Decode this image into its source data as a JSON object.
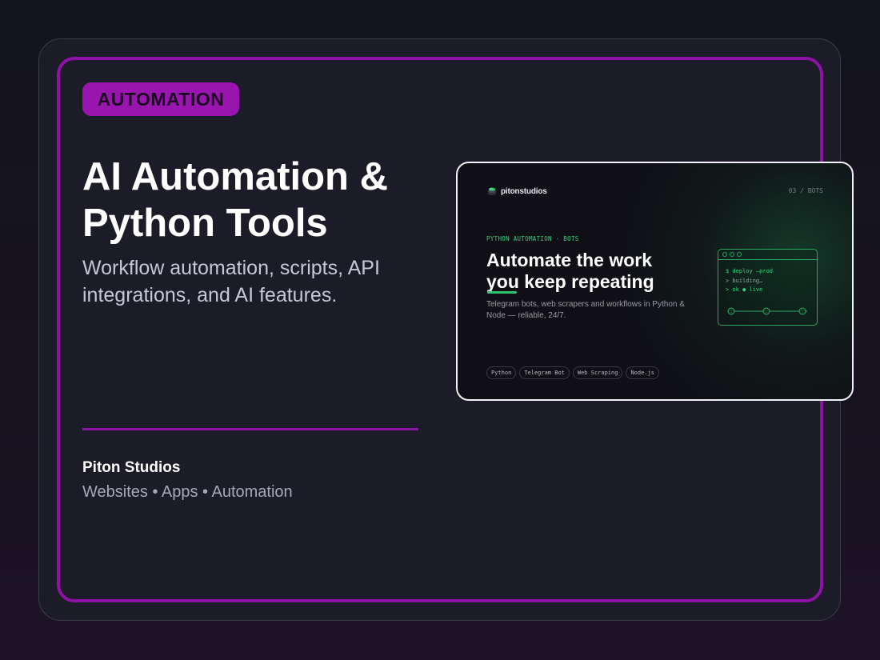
{
  "category": "AUTOMATION",
  "headline": "AI Automation & Python Tools",
  "subheadline": "Workflow automation, scripts, API integrations, and AI features.",
  "studio": {
    "name": "Piton Studios",
    "tagline": "Websites • Apps • Automation"
  },
  "colors": {
    "accent": "#8d12a6",
    "pill": "#9a14b0",
    "background": "#1c1c28",
    "preview_accent": "#35d47e"
  },
  "preview": {
    "logo_text": "pitonstudios",
    "page_index": "03 / BOTS",
    "kicker": "PYTHON AUTOMATION · BOTS",
    "title_line1": "Automate the work",
    "title_underlined": "you",
    "title_line2_rest": " keep repeating",
    "description": "Telegram bots, web scrapers and workflows in Python & Node — reliable, 24/7.",
    "terminal": {
      "line1": "$ deploy —prod",
      "line2": "> building…",
      "line3_prefix": "> ok",
      "line3_status": "● live"
    },
    "tags": [
      "Python",
      "Telegram Bot",
      "Web Scraping",
      "Node.js"
    ]
  }
}
